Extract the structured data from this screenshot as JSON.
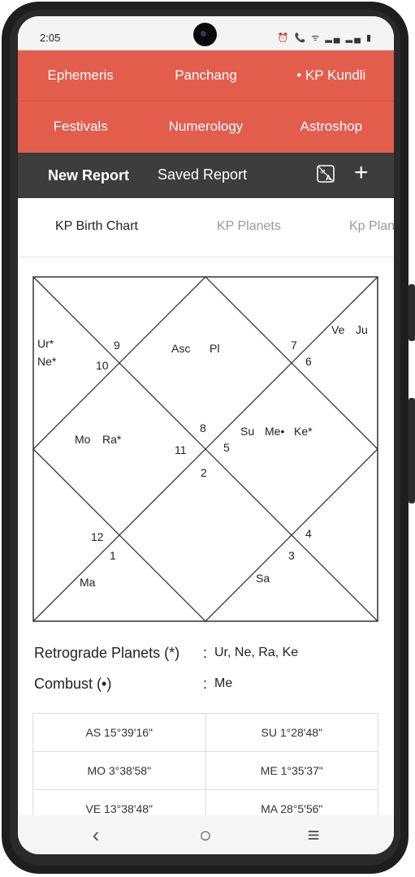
{
  "status_bar": {
    "time": "2:05",
    "icons": "⏰ 📞 ᯤ ▂▄ ▂▄ ▮"
  },
  "top_nav": {
    "row1": [
      {
        "label": "Ephemeris"
      },
      {
        "label": "Panchang"
      },
      {
        "label": "• KP Kundli"
      }
    ],
    "row2": [
      {
        "label": "Festivals"
      },
      {
        "label": "Numerology"
      },
      {
        "label": "Astroshop"
      }
    ]
  },
  "sub_bar": {
    "new_report": "New Report",
    "saved_report": "Saved Report"
  },
  "tabs": [
    "KP Birth Chart",
    "KP Planets",
    "Kp Planets"
  ],
  "chart": {
    "house_numbers": [
      "9",
      "10",
      "7",
      "6",
      "8",
      "11",
      "5",
      "2",
      "12",
      "1",
      "4",
      "3"
    ],
    "planets": {
      "ur": "Ur*",
      "ne": "Ne*",
      "asc": "Asc",
      "pl": "Pl",
      "ve": "Ve",
      "ju": "Ju",
      "mo": "Mo",
      "ra": "Ra*",
      "su": "Su",
      "me": "Me•",
      "ke": "Ke*",
      "ma": "Ma",
      "sa": "Sa"
    }
  },
  "retrograde": {
    "label": "Retrograde Planets (*)",
    "sep": ":",
    "value": "Ur, Ne, Ra, Ke"
  },
  "combust": {
    "label": "Combust (•)",
    "sep": ":",
    "value": "Me"
  },
  "degrees": [
    [
      "AS 15°39'16\"",
      "SU 1°28'48\""
    ],
    [
      "MO 3°38'58\"",
      "ME 1°35'37\""
    ],
    [
      "VE 13°38'48\"",
      "MA 28°5'56\""
    ]
  ],
  "nav_bar": {
    "back": "‹",
    "home": "○",
    "menu": "≡"
  }
}
